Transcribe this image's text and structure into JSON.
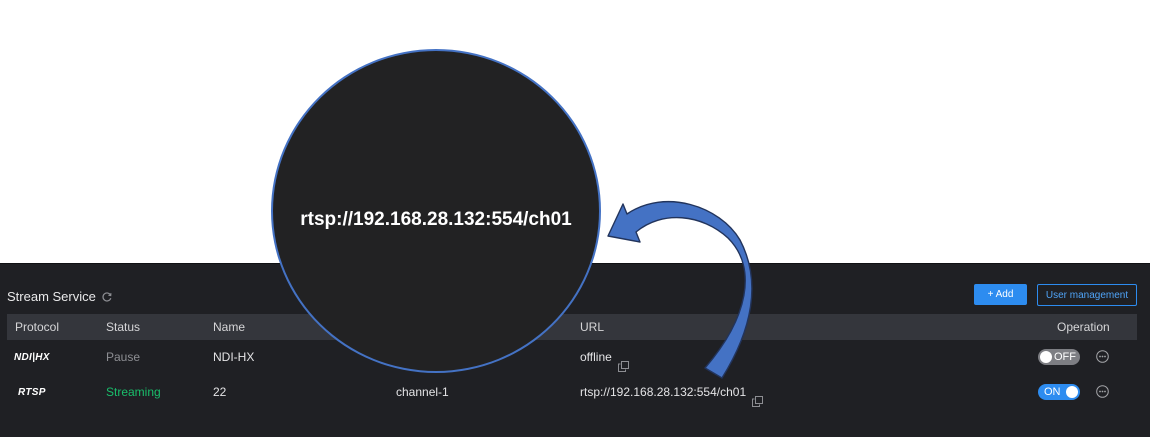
{
  "panel": {
    "title": "Stream Service",
    "add_button": "+ Add",
    "user_management_button": "User management"
  },
  "table": {
    "headers": {
      "protocol": "Protocol",
      "status": "Status",
      "name": "Name",
      "url": "URL",
      "operation": "Operation"
    },
    "rows": [
      {
        "protocol": "NDI|HX",
        "status": "Pause",
        "name": "NDI-HX",
        "source": "",
        "url": "offline",
        "toggle": "OFF",
        "enabled": false
      },
      {
        "protocol": "RTSP",
        "status": "Streaming",
        "name": "22",
        "source": "channel-1",
        "url": "rtsp://192.168.28.132:554/ch01",
        "toggle": "ON",
        "enabled": true
      }
    ]
  },
  "magnifier": {
    "text": "rtsp://192.168.28.132:554/ch01"
  },
  "colors": {
    "panel_bg": "#1f2024",
    "header_bg": "#34363c",
    "accent": "#2d8cf0",
    "streaming": "#19be6b",
    "annotation": "#4472c4"
  }
}
